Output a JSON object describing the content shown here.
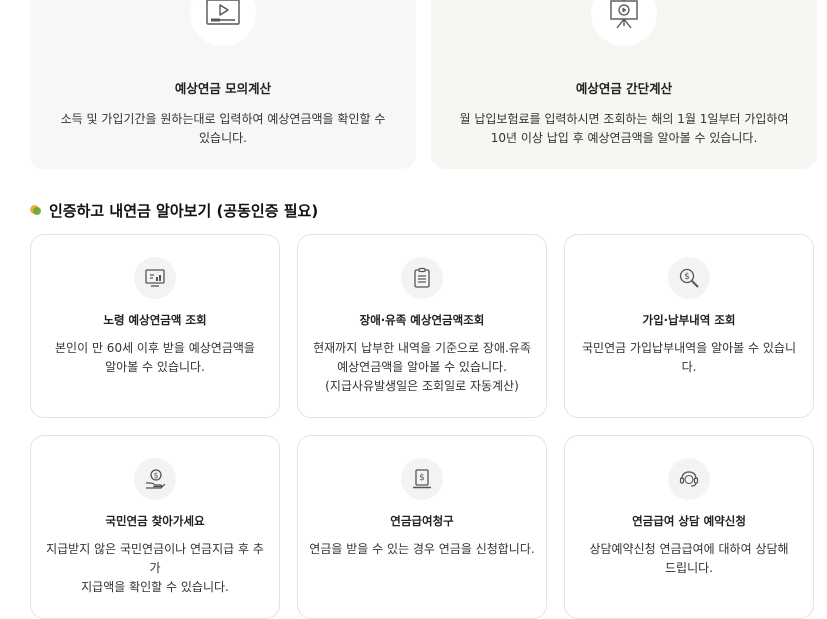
{
  "top_cards": [
    {
      "icon": "video-play-icon",
      "title": "예상연금 모의계산",
      "desc_line1": "소득 및 가입기간을 원하는대로 입력하여 예상연금액을 확인할 수",
      "desc_line2": "있습니다."
    },
    {
      "icon": "presentation-board-icon",
      "title": "예상연금 간단계산",
      "desc_line1": "월 납입보험료를 입력하시면 조회하는 해의 1월 1일부터 가입하여",
      "desc_line2": "10년 이상 납입 후 예상연금액을 알아볼 수 있습니다."
    }
  ],
  "section": {
    "title": "인증하고 내연금 알아보기 (공동인증 필요)"
  },
  "services": [
    {
      "icon": "monitor-chart-icon",
      "title": "노령 예상연금액 조회",
      "desc": [
        "본인이 만 60세 이후 받을 예상연금액을",
        "알아볼 수 있습니다."
      ]
    },
    {
      "icon": "clipboard-icon",
      "title": "장애·유족 예상연금액조회",
      "desc": [
        "현재까지 납부한 내역을 기준으로 장애.유족",
        "예상연금액을 알아볼 수 있습니다.",
        "(지급사유발생일은 조회일로 자동계산)"
      ]
    },
    {
      "icon": "magnifier-dollar-icon",
      "title": "가입·납부내역 조회",
      "desc": [
        "국민연금 가입납부내역을 알아볼 수 있습니다."
      ]
    },
    {
      "icon": "hand-coin-icon",
      "title": "국민연금 찾아가세요",
      "desc": [
        "지급받지 않은 국민연금이나 연금지급 후 추가",
        "지급액을 확인할 수 있습니다."
      ]
    },
    {
      "icon": "dollar-document-icon",
      "title": "연금급여청구",
      "desc": [
        "연금을 받을 수 있는 경우 연금을 신청합니다."
      ]
    },
    {
      "icon": "headset-icon",
      "title": "연금급여 상담 예약신청",
      "desc": [
        "상담예약신청 연금급여에 대하여 상담해",
        "드립니다."
      ]
    }
  ]
}
